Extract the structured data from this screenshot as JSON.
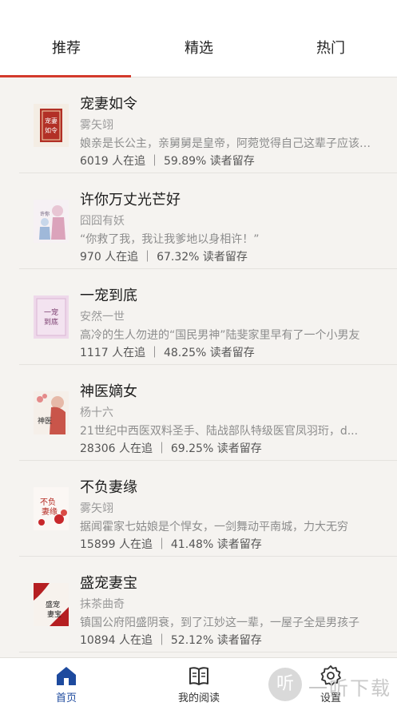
{
  "tabs": [
    {
      "label": "推荐",
      "active": true
    },
    {
      "label": "精选",
      "active": false
    },
    {
      "label": "热门",
      "active": false
    }
  ],
  "accent_color": "#d33a2c",
  "books": [
    {
      "title": "宠妻如令",
      "author": "雾矢翊",
      "desc": "娘亲是长公主，亲舅舅是皇帝，阿菀觉得自己这辈子应该可以过得很好",
      "stats": "6019 人在追 ｜ 59.89% 读者留存",
      "cover_text": "宠妻如令"
    },
    {
      "title": "许你万丈光芒好",
      "author": "囧囧有妖",
      "desc": "“你救了我，我让我爹地以身相许！”",
      "stats": "970 人在追 ｜ 67.32% 读者留存",
      "cover_text": "许你万丈光芒好"
    },
    {
      "title": "一宠到底",
      "author": "安然一世",
      "desc": "高冷的生人勿进的“国民男神”陆斐家里早有了一个小男友",
      "stats": "1117 人在追 ｜ 48.25% 读者留存",
      "cover_text": "一宠到底"
    },
    {
      "title": "神医嫡女",
      "author": "杨十六",
      "desc": "21世纪中西医双料圣手、陆战部队特级医官凤羽珩，d...",
      "stats": "28306 人在追 ｜ 69.25% 读者留存",
      "cover_text": "神医嫡女"
    },
    {
      "title": "不负妻缘",
      "author": "雾矢翊",
      "desc": "据闻霍家七姑娘是个悍女，一剑舞动平南城，力大无穷",
      "stats": "15899 人在追 ｜ 41.48% 读者留存",
      "cover_text": "不负妻缘"
    },
    {
      "title": "盛宠妻宝",
      "author": "抹茶曲奇",
      "desc": "镇国公府阳盛阴衰，到了江妙这一辈，一屋子全是男孩子",
      "stats": "10894 人在追 ｜ 52.12% 读者留存",
      "cover_text": "盛宠妻宝"
    }
  ],
  "bottom_nav": [
    {
      "label": "首页",
      "icon": "home-icon",
      "active": true
    },
    {
      "label": "我的阅读",
      "icon": "book-icon",
      "active": false
    },
    {
      "label": "设置",
      "icon": "gear-icon",
      "active": false
    }
  ],
  "nav_active_color": "#1d4a9e",
  "watermark": {
    "glyph": "听",
    "text": "一听下载"
  }
}
